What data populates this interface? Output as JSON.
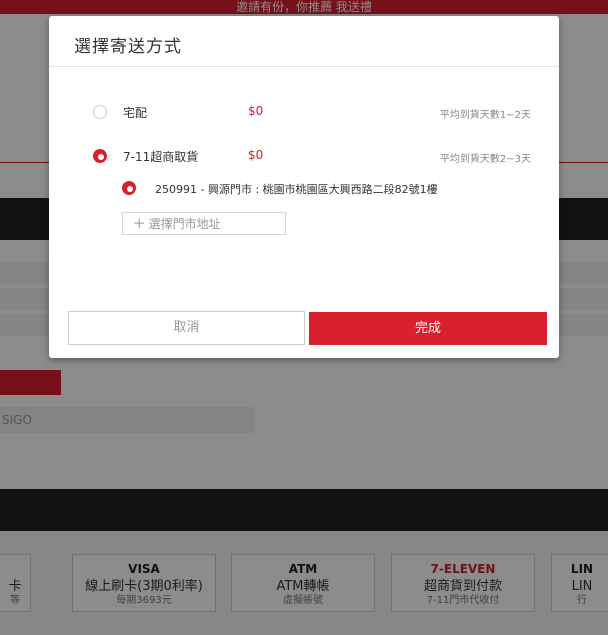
{
  "background": {
    "top_banner": "邀請有份，你推薦 我送禮",
    "coupon_placeholder": "SIGO",
    "payment_methods": [
      {
        "icon": "",
        "title": "卡",
        "sub": "等"
      },
      {
        "icon": "VISA",
        "title": "線上刷卡(3期0利率)",
        "sub": "每期3693元"
      },
      {
        "icon": "ATM",
        "title": "ATM轉帳",
        "sub": "虛擬帳號"
      },
      {
        "icon": "7-ELEVEN",
        "title": "超商貨到付款",
        "sub": "7-11門市代收付"
      },
      {
        "icon": "LIN",
        "title": "LIN",
        "sub": "行"
      }
    ]
  },
  "modal": {
    "title": "選擇寄送方式",
    "options": [
      {
        "label": "宅配",
        "price": "$0",
        "eta": "平均到貨天數1~2天",
        "selected": false
      },
      {
        "label": "7-11超商取貨",
        "price": "$0",
        "eta": "平均到貨天數2~3天",
        "selected": true
      }
    ],
    "store": {
      "text": "250991 - 興源門市 : 桃園市桃園區大興西路二段82號1樓",
      "selected": true
    },
    "add_store_label": "選擇門市地址",
    "cancel_label": "取消",
    "done_label": "完成"
  },
  "colors": {
    "accent": "#d8202e",
    "dark_band": "#1e1f22"
  }
}
